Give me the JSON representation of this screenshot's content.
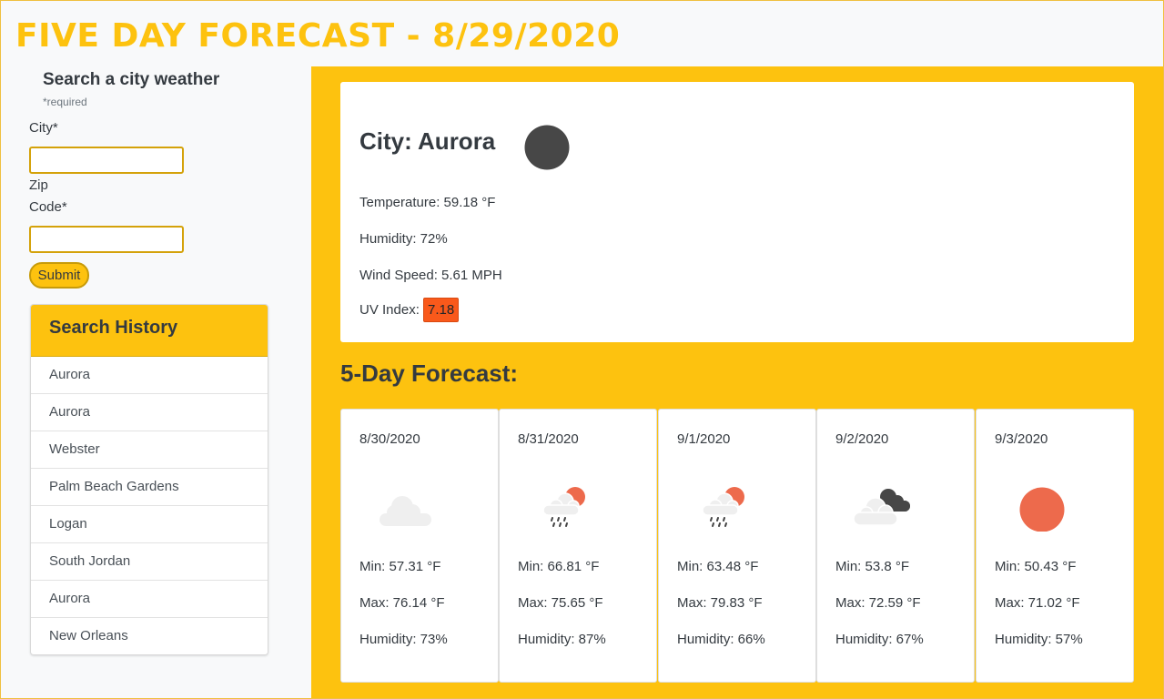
{
  "header": {
    "title": "FIVE DAY FORECAST - 8/29/2020"
  },
  "search": {
    "title": "Search a city weather",
    "required_note": "*required",
    "city_label": "City*",
    "zip_label_1": "Zip",
    "zip_label_2": "Code*",
    "city_value": "",
    "zip_value": "",
    "submit_label": "Submit"
  },
  "history": {
    "title": "Search History",
    "items": [
      "Aurora",
      "Aurora",
      "Webster",
      "Palm Beach Gardens",
      "Logan",
      "South Jordan",
      "Aurora",
      "New Orleans"
    ]
  },
  "current": {
    "city": "City: Aurora",
    "icon": "moon-icon",
    "temperature": "Temperature: 59.18 °F",
    "humidity": "Humidity: 72%",
    "wind": "Wind Speed: 5.61 MPH",
    "uv_label": "UV Index: ",
    "uv_value": "7.18",
    "uv_color": "#f9591b"
  },
  "forecast": {
    "title": "5-Day Forecast:",
    "days": [
      {
        "date": "8/30/2020",
        "icon": "cloud-icon",
        "min": "Min: 57.31 °F",
        "max": "Max: 76.14 °F",
        "humidity": "Humidity: 73%"
      },
      {
        "date": "8/31/2020",
        "icon": "rain-sun-icon",
        "min": "Min: 66.81 °F",
        "max": "Max: 75.65 °F",
        "humidity": "Humidity: 87%"
      },
      {
        "date": "9/1/2020",
        "icon": "rain-sun-icon",
        "min": "Min: 63.48 °F",
        "max": "Max: 79.83 °F",
        "humidity": "Humidity: 66%"
      },
      {
        "date": "9/2/2020",
        "icon": "broken-clouds-icon",
        "min": "Min: 53.8 °F",
        "max": "Max: 72.59 °F",
        "humidity": "Humidity: 67%"
      },
      {
        "date": "9/3/2020",
        "icon": "sun-icon",
        "min": "Min: 50.43 °F",
        "max": "Max: 71.02 °F",
        "humidity": "Humidity: 57%"
      }
    ]
  },
  "colors": {
    "accent": "#fdc20f",
    "sun": "#ed6a4c",
    "moon": "#474747"
  }
}
